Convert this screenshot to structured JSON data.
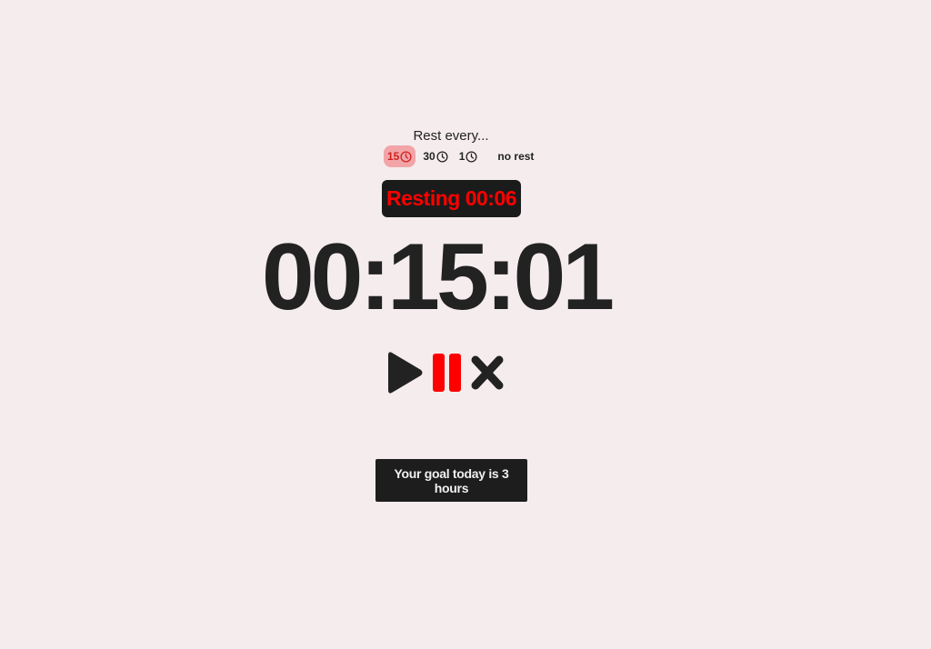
{
  "rest": {
    "title": "Rest every...",
    "options": [
      {
        "label": "15",
        "icon": "clock-icon",
        "selected": true
      },
      {
        "label": "30",
        "icon": "clock-icon",
        "selected": false
      },
      {
        "label": "1",
        "icon": "clock-icon",
        "selected": false
      },
      {
        "label": "no rest",
        "icon": "",
        "selected": false
      }
    ]
  },
  "resting_badge": "Resting 00:06",
  "timer": "00:15:01",
  "controls": {
    "play_icon": "play-icon",
    "pause_icon": "pause-icon",
    "stop_icon": "close-icon"
  },
  "goal_button": "Your goal today is 3 hours",
  "colors": {
    "background": "#f5eced",
    "accent_red": "#ff0000",
    "selected_bg": "#f2a4a7",
    "dark": "#1d1d1d"
  }
}
